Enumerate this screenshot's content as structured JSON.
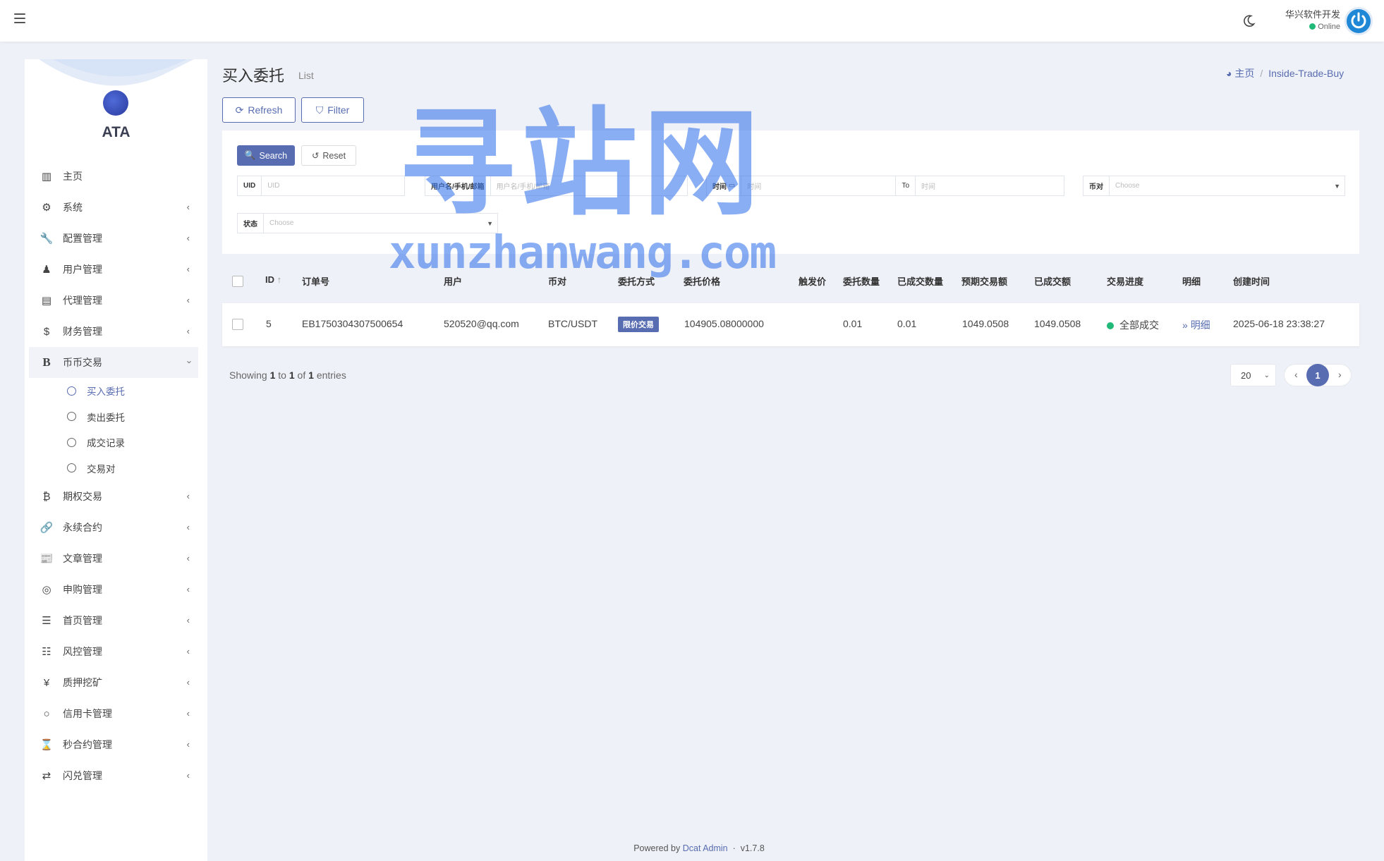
{
  "navbar": {
    "user_name": "华兴软件开发",
    "user_status": "Online"
  },
  "sidebar": {
    "logo_text": "ATA",
    "items": [
      {
        "label": "主页",
        "icon": "bar-chart-icon",
        "has_children": false
      },
      {
        "label": "系统",
        "icon": "gear-icon",
        "has_children": true
      },
      {
        "label": "配置管理",
        "icon": "wrench-icon",
        "has_children": true
      },
      {
        "label": "用户管理",
        "icon": "user-tie-icon",
        "has_children": true
      },
      {
        "label": "代理管理",
        "icon": "id-card-icon",
        "has_children": true
      },
      {
        "label": "财务管理",
        "icon": "dollar-icon",
        "has_children": true
      },
      {
        "label": "币币交易",
        "icon": "bold-b-icon",
        "has_children": true,
        "open": true,
        "children": [
          {
            "label": "买入委托",
            "active": true
          },
          {
            "label": "卖出委托",
            "active": false
          },
          {
            "label": "成交记录",
            "active": false
          },
          {
            "label": "交易对",
            "active": false
          }
        ]
      },
      {
        "label": "期权交易",
        "icon": "bitcoin-icon",
        "has_children": true
      },
      {
        "label": "永续合约",
        "icon": "link-icon",
        "has_children": true
      },
      {
        "label": "文章管理",
        "icon": "newspaper-icon",
        "has_children": true
      },
      {
        "label": "申购管理",
        "icon": "lifebuoy-icon",
        "has_children": true
      },
      {
        "label": "首页管理",
        "icon": "bars-icon",
        "has_children": true
      },
      {
        "label": "风控管理",
        "icon": "indent-icon",
        "has_children": true
      },
      {
        "label": "质押挖矿",
        "icon": "yen-icon",
        "has_children": true
      },
      {
        "label": "信用卡管理",
        "icon": "circle-icon",
        "has_children": true
      },
      {
        "label": "秒合约管理",
        "icon": "hourglass-icon",
        "has_children": true
      },
      {
        "label": "闪兑管理",
        "icon": "exchange-icon",
        "has_children": true
      }
    ]
  },
  "header": {
    "title": "买入委托",
    "subtitle": "List",
    "breadcrumb_home": "主页",
    "breadcrumb_current": "Inside-Trade-Buy"
  },
  "toolbar": {
    "refresh_label": "Refresh",
    "filter_label": "Filter"
  },
  "filter": {
    "search_label": "Search",
    "reset_label": "Reset",
    "uid_label": "UID",
    "uid_placeholder": "UID",
    "user_label": "用户名/手机/邮箱",
    "user_placeholder": "用户名/手机/邮箱",
    "time_label": "时间",
    "time_from_placeholder": "时间",
    "time_to_label": "To",
    "time_to_placeholder": "时间",
    "pair_label": "币对",
    "pair_placeholder": "Choose",
    "status_label": "状态",
    "status_placeholder": "Choose"
  },
  "table": {
    "columns": [
      "ID",
      "订单号",
      "用户",
      "币对",
      "委托方式",
      "委托价格",
      "触发价",
      "委托数量",
      "已成交数量",
      "预期交易额",
      "已成交额",
      "交易进度",
      "明细",
      "创建时间"
    ],
    "rows": [
      {
        "id": "5",
        "order_no": "EB1750304307500654",
        "user": "520520@qq.com",
        "pair": "BTC/USDT",
        "type": "限价交易",
        "price": "104905.08000000",
        "trigger": "",
        "amount": "0.01",
        "filled": "0.01",
        "expected_total": "1049.0508",
        "filled_total": "1049.0508",
        "progress": "全部成交",
        "detail": "明细",
        "created_at": "2025-06-18 23:38:27"
      }
    ]
  },
  "pagination": {
    "showing_prefix": "Showing",
    "from": "1",
    "to_word": "to",
    "to": "1",
    "of_word": "of",
    "total": "1",
    "entries_word": "entries",
    "per_page": "20",
    "current_page": "1"
  },
  "footer": {
    "powered_by": "Powered by",
    "link": "Dcat Admin",
    "version": "v1.7.8"
  },
  "watermark": {
    "cn": "寻站网",
    "en": "xunzhanwang.com"
  },
  "colors": {
    "accent": "#586cb1",
    "success": "#21b978",
    "background": "#eef1f7"
  }
}
